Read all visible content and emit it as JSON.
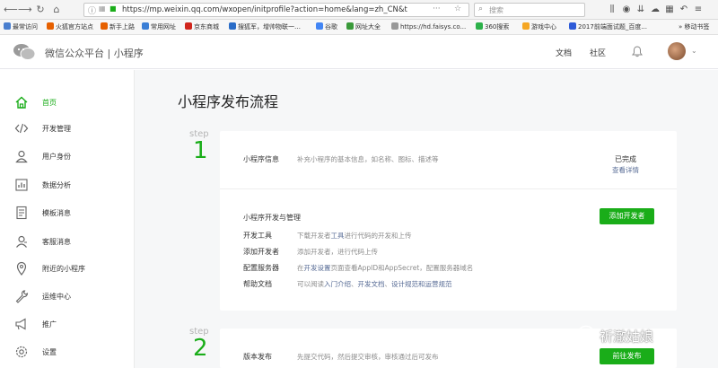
{
  "browser": {
    "url": "https://mp.weixin.qq.com/wxopen/initprofile?action=home&lang=zh_CN&t",
    "search_placeholder": "搜索",
    "bookmarks": [
      "最常访问",
      "火狐官方站点",
      "新手上路",
      "常用网址",
      "京东商城",
      "搜狐军，增帅物联一…",
      "谷歌",
      "网址大全",
      "https://hd.faisys.co...",
      "360搜索",
      "游戏中心",
      "2017前端面试题_百度...",
      "移动书签"
    ]
  },
  "header": {
    "site_title": "微信公众平台 | 小程序",
    "docs_link": "文档",
    "community_link": "社区"
  },
  "sidebar": {
    "items": [
      {
        "label": "首页",
        "icon": "home-icon"
      },
      {
        "label": "开发管理",
        "icon": "code-icon"
      },
      {
        "label": "用户身份",
        "icon": "user-icon"
      },
      {
        "label": "数据分析",
        "icon": "chart-icon"
      },
      {
        "label": "模板消息",
        "icon": "template-icon"
      },
      {
        "label": "客服消息",
        "icon": "service-icon"
      },
      {
        "label": "附近的小程序",
        "icon": "location-icon"
      },
      {
        "label": "运维中心",
        "icon": "wrench-icon"
      },
      {
        "label": "推广",
        "icon": "megaphone-icon"
      },
      {
        "label": "设置",
        "icon": "settings-icon"
      }
    ]
  },
  "main": {
    "title": "小程序发布流程",
    "step1": {
      "word": "step",
      "number": "1",
      "info": {
        "label": "小程序信息",
        "desc": "补充小程序的基本信息，如名称、图标、描述等",
        "status": "已完成",
        "detail_link": "查看详情"
      },
      "dev": {
        "label": "小程序开发与管理",
        "button": "添加开发者",
        "rows": [
          {
            "label": "开发工具",
            "desc_pre": "下载开发者",
            "desc_link": "工具",
            "desc_post": "进行代码的开发和上传"
          },
          {
            "label": "添加开发者",
            "desc_pre": "添加开发者，进行代码上传",
            "desc_link": "",
            "desc_post": ""
          },
          {
            "label": "配置服务器",
            "desc_pre": "在",
            "desc_link": "开发设置",
            "desc_post": "页面查看AppID和AppSecret，配置服务器域名"
          }
        ],
        "help": {
          "label": "帮助文档",
          "pre": "可以阅读",
          "link1": "入门介绍",
          "link2": "开发文档",
          "link3": "设计规范和运营规范",
          "sep": "、"
        }
      }
    },
    "step2": {
      "word": "step",
      "number": "2",
      "label": "版本发布",
      "desc": "先提交代码，然后提交审核，审核通过后可发布",
      "button": "前往发布"
    }
  },
  "watermark": "祈澈姑娘",
  "colors": {
    "accent": "#1aad19",
    "link": "#576b95"
  }
}
